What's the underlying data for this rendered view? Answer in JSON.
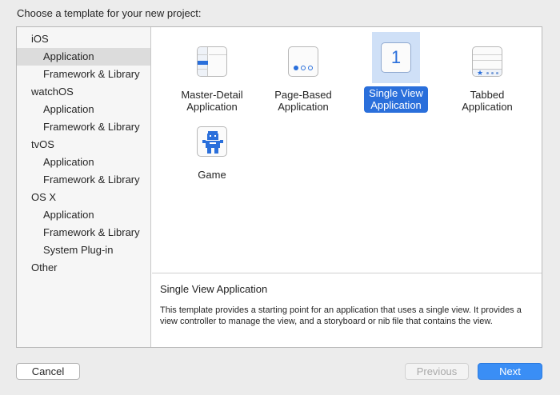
{
  "header": {
    "title": "Choose a template for your new project:"
  },
  "sidebar": {
    "groups": [
      {
        "platform": "iOS",
        "items": [
          "Application",
          "Framework & Library"
        ]
      },
      {
        "platform": "watchOS",
        "items": [
          "Application",
          "Framework & Library"
        ]
      },
      {
        "platform": "tvOS",
        "items": [
          "Application",
          "Framework & Library"
        ]
      },
      {
        "platform": "OS X",
        "items": [
          "Application",
          "Framework & Library",
          "System Plug-in"
        ]
      },
      {
        "platform": "Other",
        "items": []
      }
    ],
    "selected": "iOS / Application"
  },
  "templates": [
    {
      "label": "Master-Detail\nApplication",
      "icon": "master-detail-icon"
    },
    {
      "label": "Page-Based\nApplication",
      "icon": "page-based-icon"
    },
    {
      "label": "Single View\nApplication",
      "icon": "single-view-icon",
      "icon_text": "1",
      "selected": true
    },
    {
      "label": "Tabbed\nApplication",
      "icon": "tabbed-icon"
    },
    {
      "label": "Game",
      "icon": "game-icon"
    }
  ],
  "description": {
    "title": "Single View Application",
    "text": "This template provides a starting point for an application that uses a single view. It provides a view controller to manage the view, and a storyboard or nib file that contains the view."
  },
  "buttons": {
    "cancel": "Cancel",
    "previous": "Previous",
    "next": "Next"
  },
  "colors": {
    "accent": "#2a6fdb",
    "next_button": "#3a8ef5",
    "selection_bg": "#cfe0f7"
  }
}
